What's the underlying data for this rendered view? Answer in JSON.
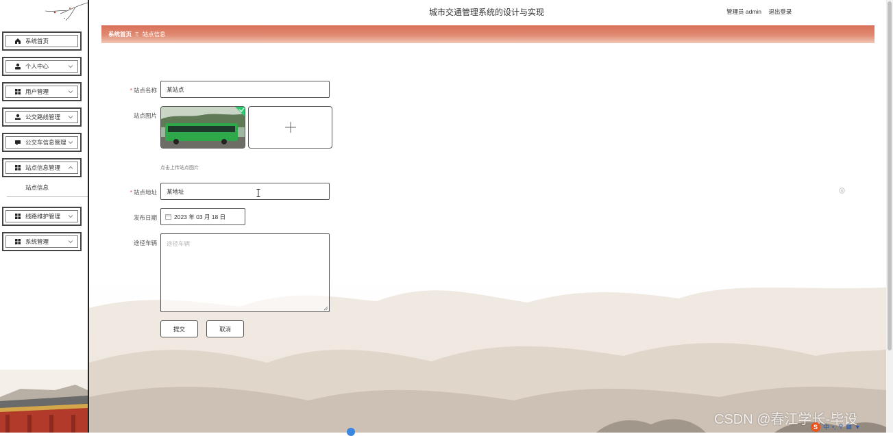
{
  "header": {
    "title": "城市交通管理系统的设计与实现",
    "user_role": "管理员 admin",
    "logout": "退出登录"
  },
  "breadcrumb": {
    "home": "系统首页",
    "separator": "Ξ",
    "current": "站点信息"
  },
  "sidebar": {
    "items": [
      {
        "label": "系统首页",
        "icon": "home-icon"
      },
      {
        "label": "个人中心",
        "icon": "user-icon"
      },
      {
        "label": "用户管理",
        "icon": "grid-icon"
      },
      {
        "label": "公交路线管理",
        "icon": "user-icon"
      },
      {
        "label": "公交车信息管理",
        "icon": "card-icon"
      },
      {
        "label": "站点信息管理",
        "icon": "grid-icon"
      },
      {
        "label": "线路维护管理",
        "icon": "grid-icon"
      },
      {
        "label": "系统管理",
        "icon": "grid-icon"
      }
    ],
    "submenu": {
      "label": "站点信息"
    }
  },
  "form": {
    "station_name": {
      "label": "站点名称",
      "value": "某站点"
    },
    "station_image": {
      "label": "站点图片",
      "hint": "点击上传站点图片"
    },
    "station_address": {
      "label": "站点地址",
      "value": "某地址"
    },
    "publish_date": {
      "label": "发布日期",
      "value": "2023 年 03 月 18 日"
    },
    "vehicles": {
      "label": "途径车辆",
      "placeholder": "途径车辆"
    },
    "submit": "提交",
    "cancel": "取消"
  },
  "watermark": "CSDN @春江学长-毕设",
  "tray": {
    "ime": "中"
  },
  "colors": {
    "breadcrumb_bg": "#d9705a",
    "required_mark": "#e74c3c",
    "accent_green": "#2ecc71"
  }
}
